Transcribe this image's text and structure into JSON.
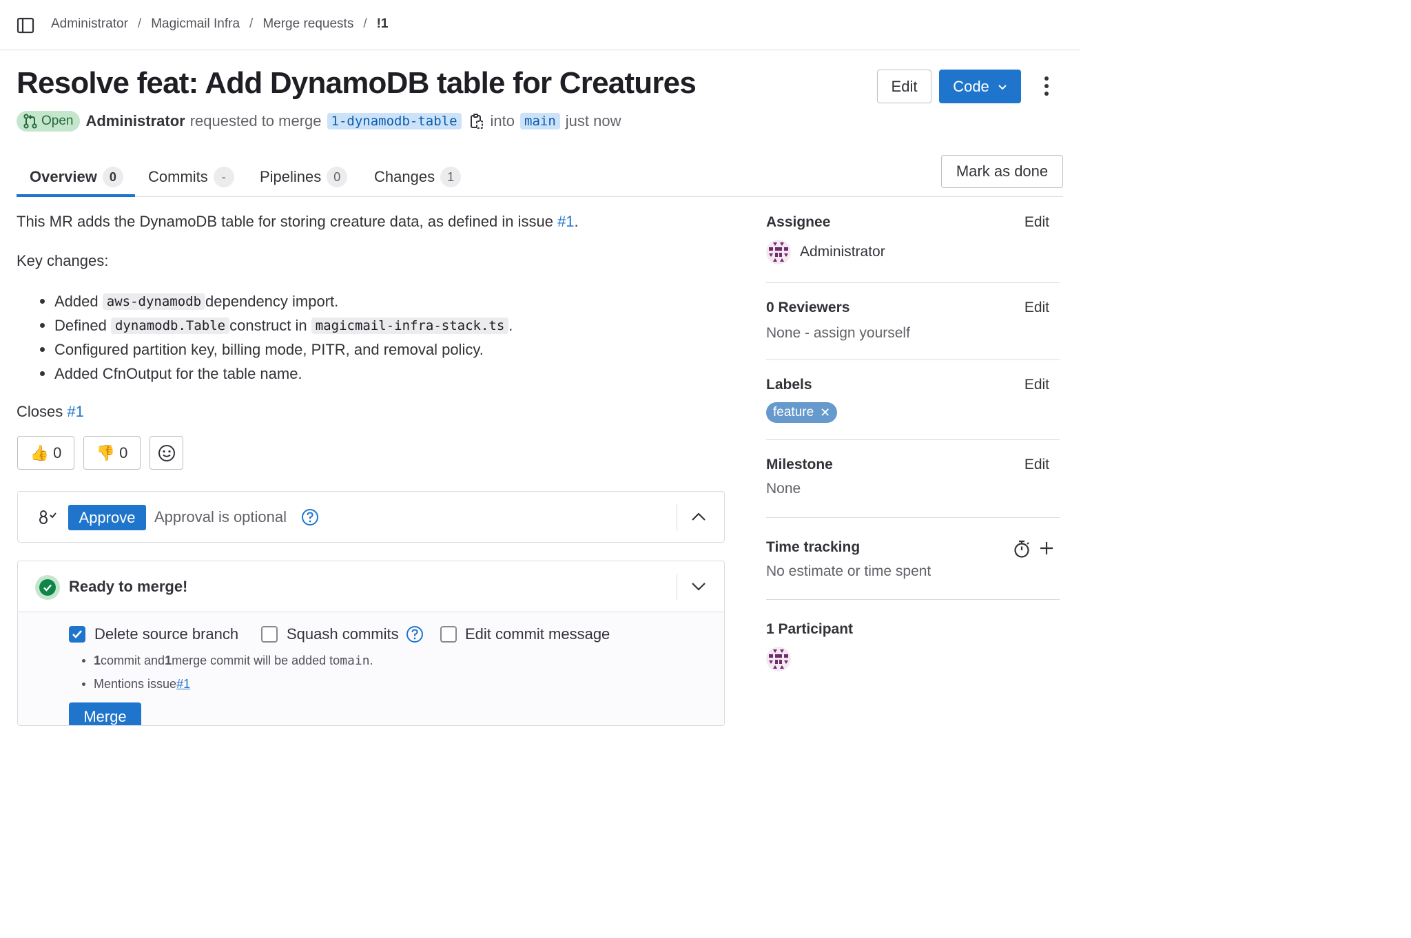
{
  "breadcrumb": [
    "Administrator",
    "Magicmail Infra",
    "Merge requests",
    "!1"
  ],
  "title": "Resolve feat: Add DynamoDB table for Creatures",
  "header_buttons": {
    "edit": "Edit",
    "code": "Code"
  },
  "meta": {
    "status": "Open",
    "author": "Administrator",
    "action": "requested to merge",
    "source_branch": "1-dynamodb-table",
    "into": "into",
    "target_branch": "main",
    "time": "just now"
  },
  "tabs": [
    {
      "label": "Overview",
      "count": "0"
    },
    {
      "label": "Commits",
      "count": "-"
    },
    {
      "label": "Pipelines",
      "count": "0"
    },
    {
      "label": "Changes",
      "count": "1"
    }
  ],
  "mark_done": "Mark as done",
  "description": {
    "intro": "This MR adds the DynamoDB table for storing creature data, as defined in issue ",
    "intro_link": "#1",
    "intro_end": ".",
    "key_changes": "Key changes:",
    "items": [
      {
        "pre": "Added ",
        "code": "aws-dynamodb",
        "post": " dependency import."
      },
      {
        "pre": "Defined ",
        "code": "dynamodb.Table",
        "mid": " construct in ",
        "code2": "magicmail-infra-stack.ts",
        "post": "."
      },
      {
        "pre": "Configured partition key, billing mode, PITR, and removal policy."
      },
      {
        "pre": "Added CfnOutput for the table name."
      }
    ],
    "closes": "Closes ",
    "closes_link": "#1"
  },
  "reactions": {
    "thumbs_up": "0",
    "thumbs_down": "0"
  },
  "approval": {
    "button": "Approve",
    "text": "Approval is optional"
  },
  "merge": {
    "status": "Ready to merge!",
    "delete_branch": "Delete source branch",
    "squash": "Squash commits",
    "edit_message": "Edit commit message",
    "info1_a": "1",
    "info1_b": " commit and ",
    "info1_c": "1",
    "info1_d": " merge commit will be added to ",
    "info1_e": "main",
    "info1_f": ".",
    "info2": "Mentions issue ",
    "info2_link": "#1",
    "button": "Merge"
  },
  "sidebar": {
    "edit": "Edit",
    "assignee_title": "Assignee",
    "assignee_name": "Administrator",
    "reviewers_title": "0 Reviewers",
    "reviewers_value": "None - assign yourself",
    "labels_title": "Labels",
    "label": "feature",
    "milestone_title": "Milestone",
    "milestone_value": "None",
    "time_title": "Time tracking",
    "time_value": "No estimate or time spent",
    "participants_title": "1 Participant"
  },
  "colors": {
    "accent": "#1f75cb",
    "open_badge_bg": "#c3e6cd",
    "open_badge_text": "#24663b",
    "label_feature": "#6699cc",
    "success": "#108548"
  }
}
